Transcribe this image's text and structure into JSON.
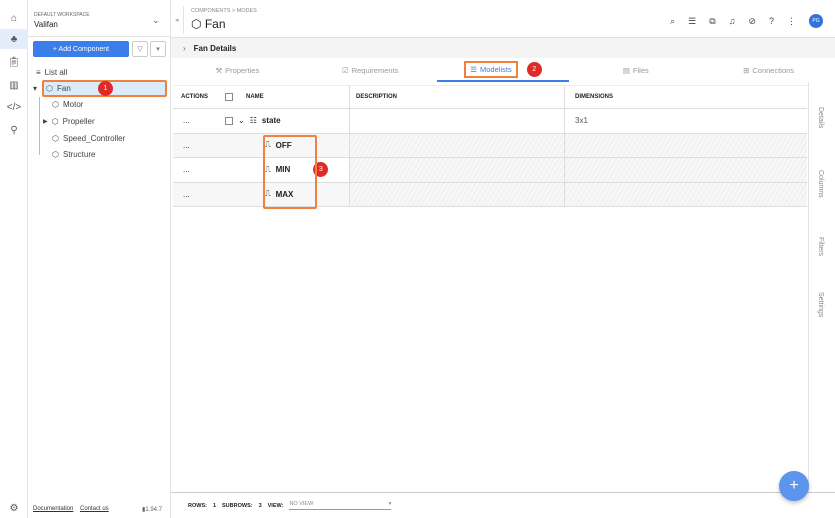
{
  "rail": {
    "icons": [
      "home-icon",
      "components-icon",
      "clipboard-icon",
      "analytics-icon",
      "code-icon",
      "link-icon"
    ],
    "settings_icon": "gear-icon"
  },
  "sidebar": {
    "workspace_label": "DEFAULT WORKSPACE",
    "workspace_name": "Valifan",
    "add_component": "+ Add Component",
    "filter_icon": "▽",
    "more_icon": "▾",
    "list_all": "List all",
    "tree": [
      {
        "label": "Fan",
        "badge": "1"
      },
      {
        "label": "Motor"
      },
      {
        "label": "Propeller"
      },
      {
        "label": "Speed_Controller"
      },
      {
        "label": "Structure"
      }
    ],
    "footer": {
      "documentation": "Documentation",
      "contact": "Contact us",
      "version": "1.94.7"
    }
  },
  "header": {
    "breadcrumb": "COMPONENTS > MODES",
    "title": "Fan",
    "avatar": "PG"
  },
  "details_bar": "Fan Details",
  "tabs": [
    {
      "label": "Properties",
      "icon": "⚒"
    },
    {
      "label": "Requirements",
      "icon": "☑"
    },
    {
      "label": "Modelists",
      "icon": "☰",
      "badge": "2"
    },
    {
      "label": "Files",
      "icon": "▤"
    },
    {
      "label": "Connections",
      "icon": "⊞"
    }
  ],
  "table": {
    "headers": {
      "actions": "ACTIONS",
      "name": "NAME",
      "description": "DESCRIPTION",
      "dimensions": "DIMENSIONS"
    },
    "rows": [
      {
        "actions": "...",
        "name": "state",
        "description": "",
        "dimensions": "3x1"
      }
    ],
    "subrows": [
      {
        "actions": "...",
        "name": "OFF"
      },
      {
        "actions": "...",
        "name": "MIN"
      },
      {
        "actions": "...",
        "name": "MAX"
      }
    ],
    "sub_badge": "3"
  },
  "right_panel": [
    "Details",
    "Columns",
    "Filters",
    "Settings"
  ],
  "footer": {
    "rows_label": "ROWS:",
    "rows": "1",
    "subrows_label": "SUBROWS:",
    "subrows": "3",
    "view_label": "VIEW:",
    "view_value": "NO VIEW"
  },
  "fab": "+"
}
